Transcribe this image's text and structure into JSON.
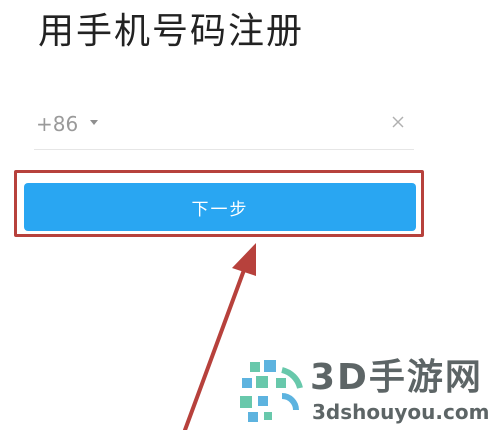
{
  "page": {
    "title": "用手机号码注册"
  },
  "phone": {
    "country_code": "+86",
    "value": "",
    "placeholder": ""
  },
  "next_button": {
    "label": "下一步"
  },
  "icons": {
    "country_dropdown": "caret-down-icon",
    "clear": "close-icon",
    "annotation_arrow": "arrow-annotation-icon",
    "watermark_logo": "pixel-logo-icon"
  },
  "colors": {
    "button": "#29a6f2",
    "highlight_border": "#b7413c",
    "arrow": "#b7413c",
    "watermark_green": "#2fb48c",
    "watermark_blue": "#1f97d4"
  },
  "watermark": {
    "brand": "3D手游网",
    "domain": "3dshouyou.com"
  }
}
